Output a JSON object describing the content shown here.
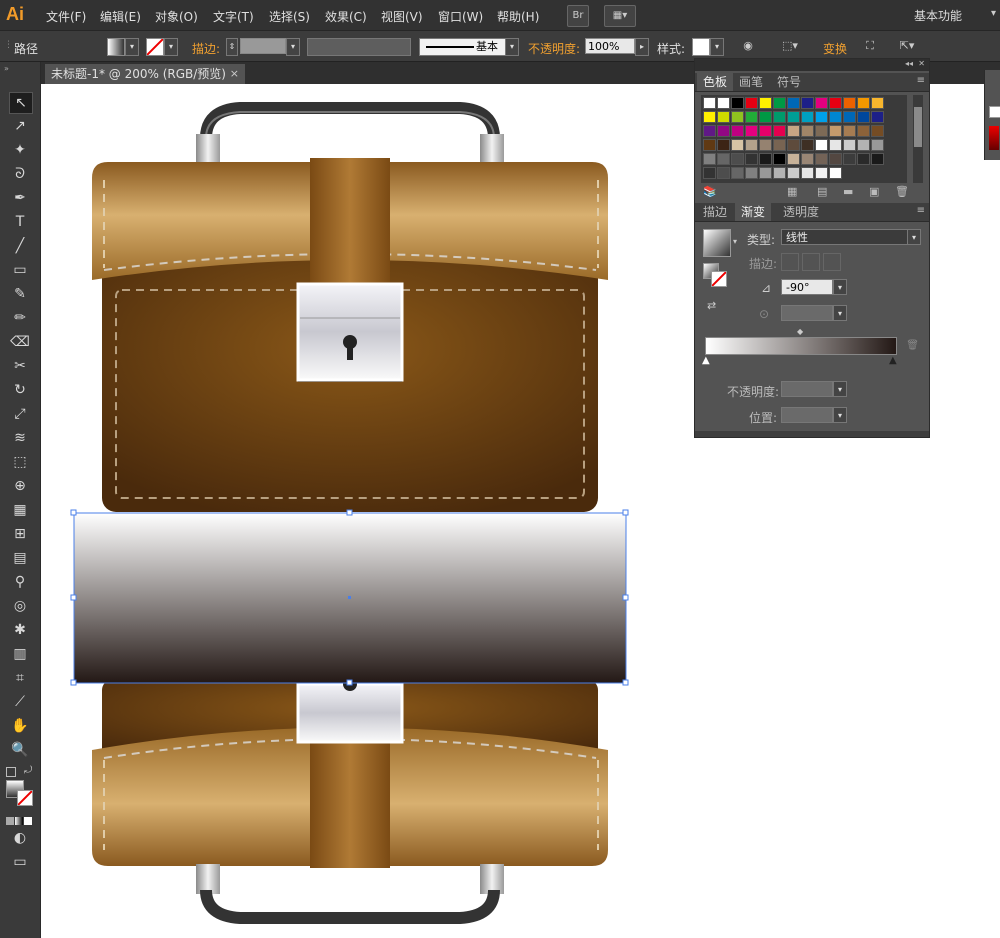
{
  "app": {
    "logo": "Ai"
  },
  "menu": {
    "items": [
      "文件(F)",
      "编辑(E)",
      "对象(O)",
      "文字(T)",
      "选择(S)",
      "效果(C)",
      "视图(V)",
      "窗口(W)",
      "帮助(H)"
    ],
    "bridge_label": "Br",
    "workspace": "基本功能"
  },
  "control": {
    "object_type": "路径",
    "stroke_label": "描边:",
    "stroke_style": "基本",
    "opacity_label": "不透明度:",
    "opacity_value": "100%",
    "style_label": "样式:",
    "transform_label": "变换"
  },
  "document": {
    "tab_title": "未标题-1* @ 200% (RGB/预览)",
    "close": "×"
  },
  "swatches_panel": {
    "tabs": [
      "色板",
      "画笔",
      "符号"
    ],
    "rows": [
      [
        "#ffffff",
        "#ffffff",
        "#000000",
        "#e60012",
        "#fff100",
        "#009944",
        "#0068b7",
        "#1d2088",
        "#e4007f",
        "#e60012",
        "#eb6100",
        "#f39800",
        "#f8b62d"
      ],
      [
        "#fff100",
        "#cfdb00",
        "#8fc31f",
        "#22ac38",
        "#009944",
        "#009b6b",
        "#009e96",
        "#00a0c1",
        "#00a0e9",
        "#0086d1",
        "#0068b7",
        "#00479d",
        "#1d2088"
      ],
      [
        "#601986",
        "#920783",
        "#be0081",
        "#e4007f",
        "#e5006a",
        "#e5004f",
        "#c8a584",
        "#a08568",
        "#7d6a56",
        "#c49a6c",
        "#a67c52",
        "#8c6239",
        "#754c24"
      ],
      [
        "#603913",
        "#3c2415",
        "#d7c4a5",
        "#b3a28c",
        "#958270",
        "#786452",
        "#5e4b3c",
        "#3e2f24",
        "#ffffff",
        "#e6e6e6",
        "#cccccc",
        "#b3b3b3",
        "#999999"
      ],
      [
        "#808080",
        "#666666",
        "#4d4d4d",
        "#333333",
        "#1a1a1a",
        "#000000",
        "#c7b299",
        "#998675",
        "#736357",
        "#534741",
        "#3c3c3c",
        "#2a2a2a",
        "#1a1a1a"
      ],
      [
        "#333333",
        "#4d4d4d",
        "#666666",
        "#808080",
        "#999999",
        "#b3b3b3",
        "#cccccc",
        "#e6e6e6",
        "#f2f2f2",
        "#ffffff"
      ]
    ]
  },
  "gradient_panel": {
    "tabs": [
      "描边",
      "渐变",
      "透明度"
    ],
    "type_label": "类型:",
    "type_value": "线性",
    "stroke_label": "描边:",
    "angle_value": "-90°",
    "opacity_label": "不透明度:",
    "position_label": "位置:",
    "gradient_start": "#ffffff",
    "gradient_end": "#231815"
  },
  "colors": {
    "leather_dark": "#5a3510",
    "leather_mid": "#8a5a20",
    "leather_light": "#d8b070",
    "selection": "#4a7fe8",
    "accent_orange": "#f0a030"
  }
}
